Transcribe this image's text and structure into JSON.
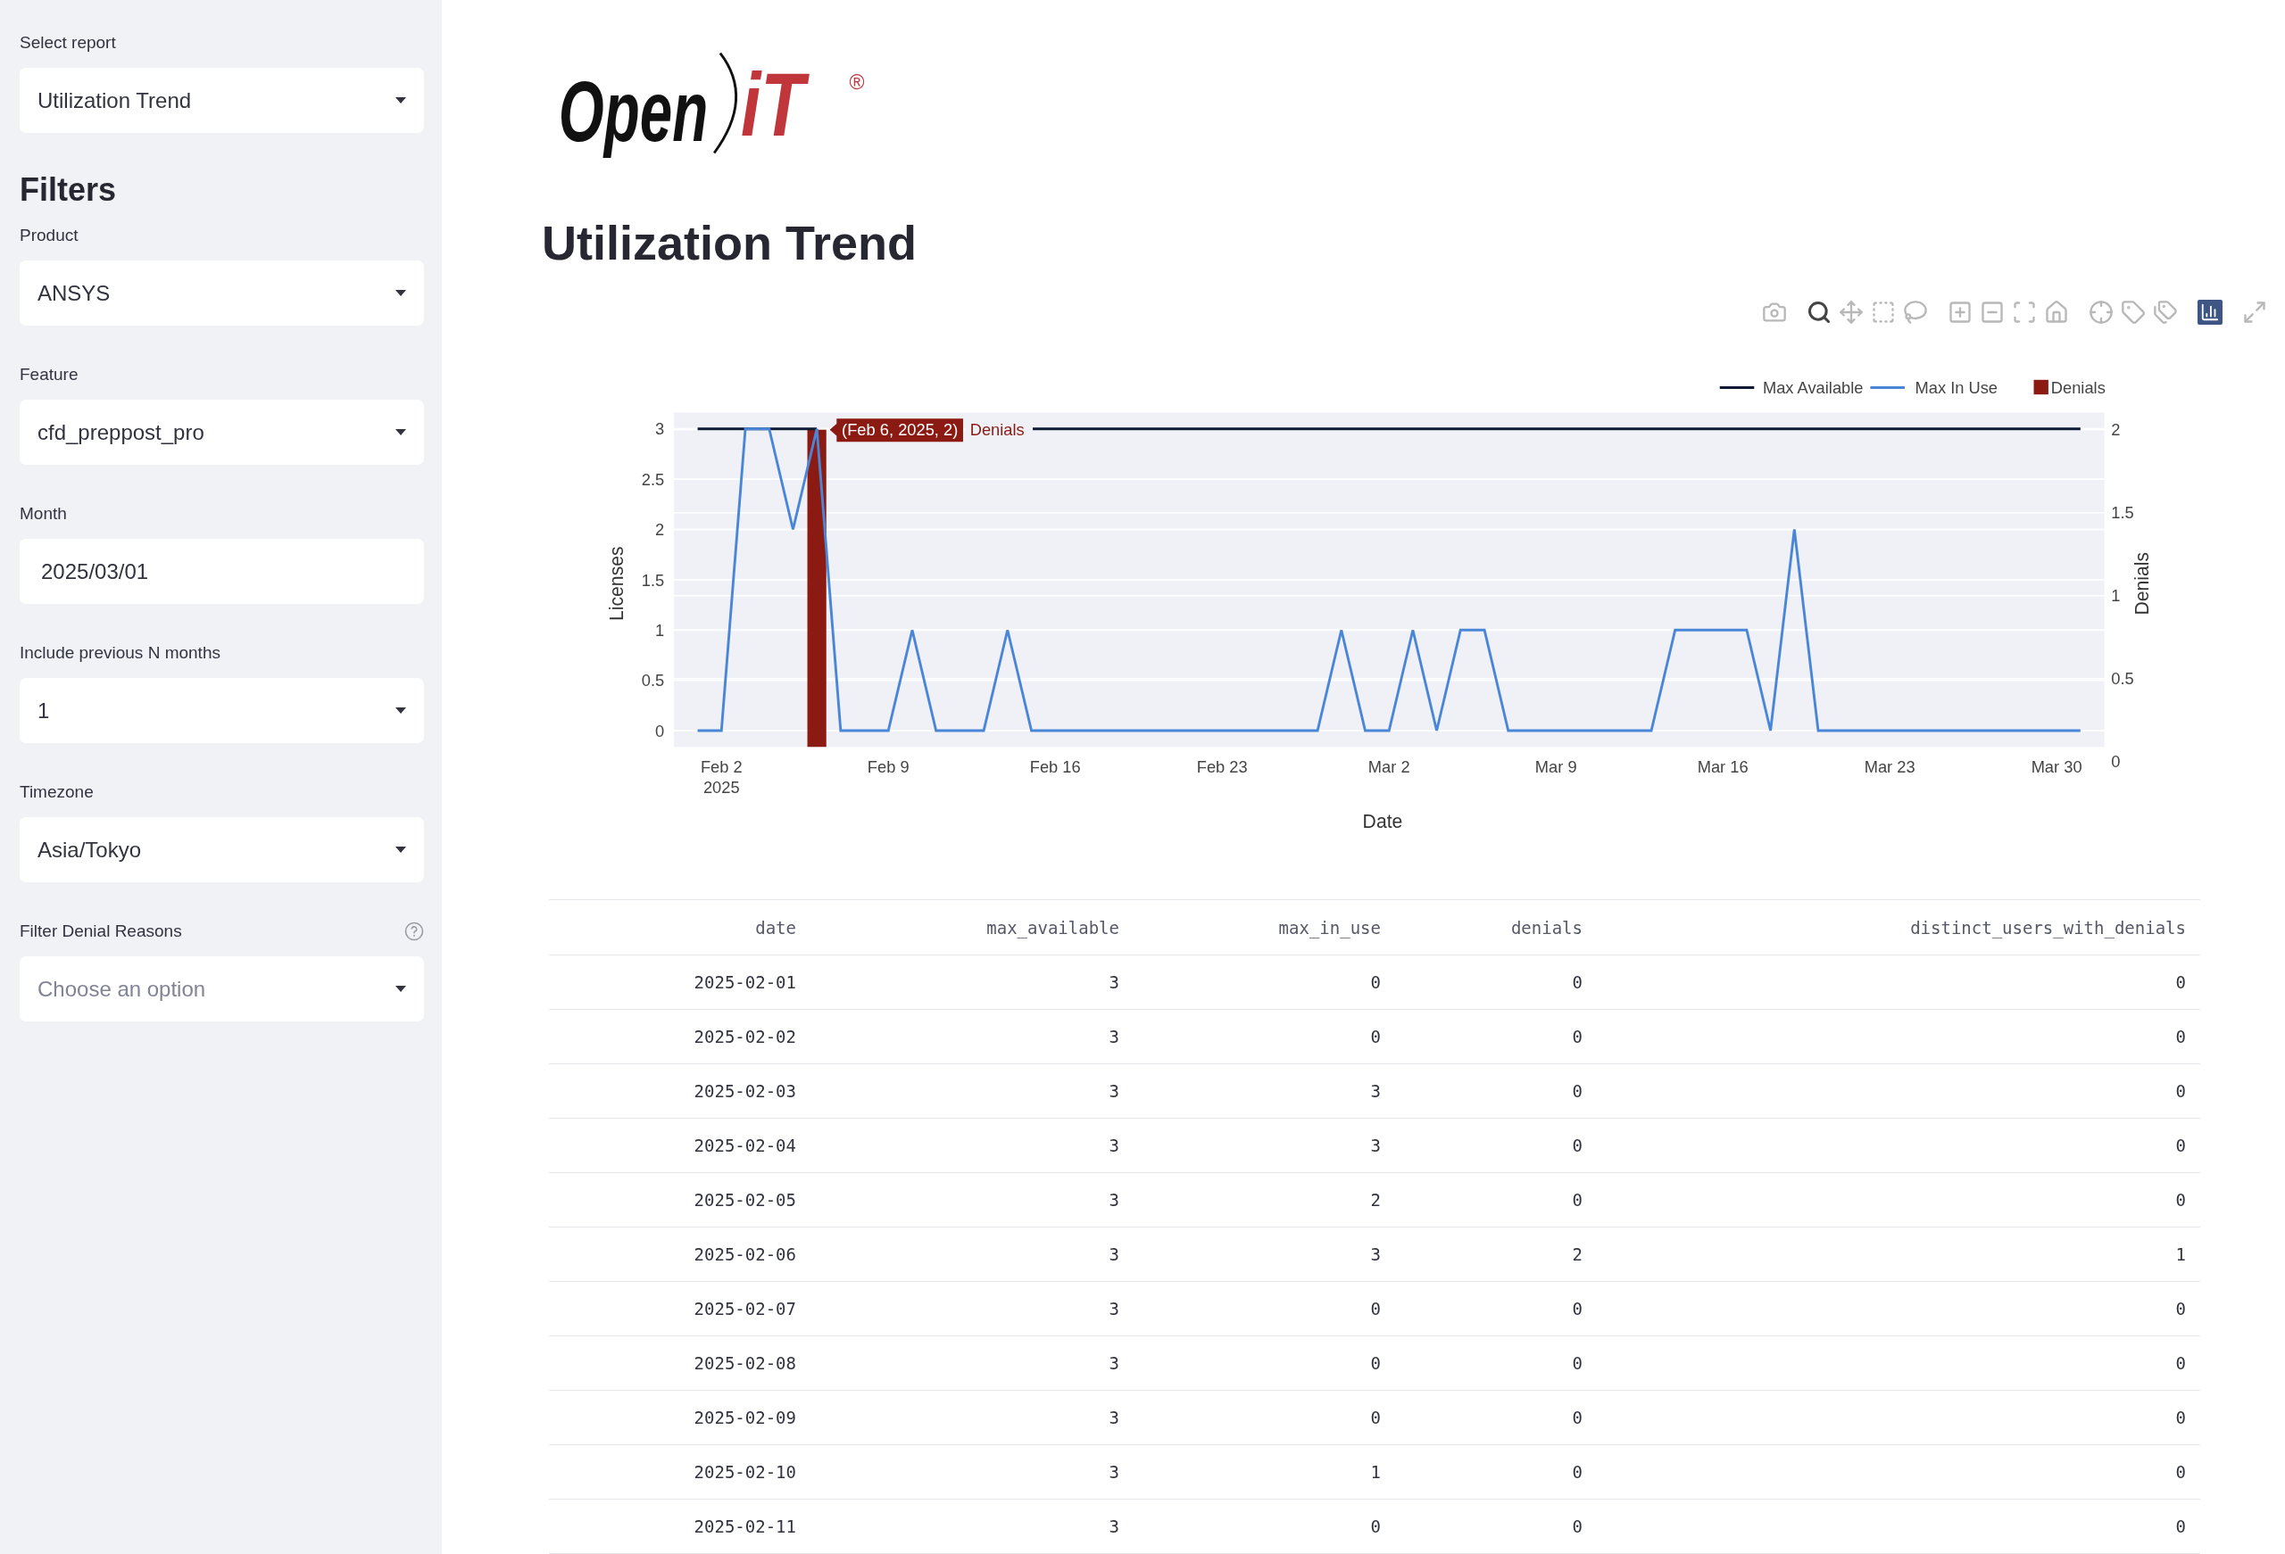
{
  "sidebar": {
    "report": {
      "label": "Select report",
      "value": "Utilization Trend"
    },
    "heading": "Filters",
    "filters": [
      {
        "kind": "select",
        "label": "Product",
        "value": "ANSYS",
        "help": false
      },
      {
        "kind": "select",
        "label": "Feature",
        "value": "cfd_preppost_pro",
        "help": false
      },
      {
        "kind": "date",
        "label": "Month",
        "value": "2025/03/01",
        "help": false
      },
      {
        "kind": "select",
        "label": "Include previous N months",
        "value": "1",
        "help": false
      },
      {
        "kind": "select",
        "label": "Timezone",
        "value": "Asia/Tokyo",
        "help": false
      },
      {
        "kind": "multiselect",
        "label": "Filter Denial Reasons",
        "placeholder": "Choose an option",
        "help": true
      }
    ]
  },
  "logo": {
    "word": "Open",
    "accent": "iT",
    "mark": "®"
  },
  "title": "Utilization Trend",
  "modebar": [
    {
      "kind": "camera",
      "selected": false
    },
    {
      "kind": "zoom",
      "selected": true
    },
    {
      "kind": "pan",
      "selected": false
    },
    {
      "kind": "box-select",
      "selected": false
    },
    {
      "kind": "lasso",
      "selected": false
    },
    {
      "kind": "zoom-in",
      "selected": false
    },
    {
      "kind": "zoom-out",
      "selected": false
    },
    {
      "kind": "autoscale",
      "selected": false
    },
    {
      "kind": "home",
      "selected": false
    },
    {
      "kind": "spikelines",
      "selected": false
    },
    {
      "kind": "hover-closest",
      "selected": false
    },
    {
      "kind": "hover-compare",
      "selected": false
    },
    {
      "kind": "logo",
      "selected": false
    },
    {
      "kind": "fullscreen",
      "selected": false
    }
  ],
  "chart": {
    "chart_data": {
      "type": "line",
      "xlabel": "Date",
      "ylabel": "Licenses",
      "y2label": "Denials",
      "x": [
        "2025-02-01",
        "2025-02-02",
        "2025-02-03",
        "2025-02-04",
        "2025-02-05",
        "2025-02-06",
        "2025-02-07",
        "2025-02-08",
        "2025-02-09",
        "2025-02-10",
        "2025-02-11",
        "2025-02-12",
        "2025-02-13",
        "2025-02-14",
        "2025-02-15",
        "2025-02-16",
        "2025-02-17",
        "2025-02-18",
        "2025-02-19",
        "2025-02-20",
        "2025-02-21",
        "2025-02-22",
        "2025-02-23",
        "2025-02-24",
        "2025-02-25",
        "2025-02-26",
        "2025-02-27",
        "2025-02-28",
        "2025-03-01",
        "2025-03-02",
        "2025-03-03",
        "2025-03-04",
        "2025-03-05",
        "2025-03-06",
        "2025-03-07",
        "2025-03-08",
        "2025-03-09",
        "2025-03-10",
        "2025-03-11",
        "2025-03-12",
        "2025-03-13",
        "2025-03-14",
        "2025-03-15",
        "2025-03-16",
        "2025-03-17",
        "2025-03-18",
        "2025-03-19",
        "2025-03-20",
        "2025-03-21",
        "2025-03-22",
        "2025-03-23",
        "2025-03-24",
        "2025-03-25",
        "2025-03-26",
        "2025-03-27",
        "2025-03-28",
        "2025-03-29",
        "2025-03-30",
        "2025-03-31"
      ],
      "series": [
        {
          "name": "Max Available",
          "color": "#0e1a33",
          "values": [
            3,
            3,
            3,
            3,
            3,
            3,
            null,
            null,
            null,
            null,
            null,
            null,
            null,
            null,
            3,
            3,
            3,
            3,
            3,
            3,
            3,
            3,
            3,
            3,
            3,
            3,
            3,
            3,
            3,
            3,
            3,
            3,
            3,
            3,
            3,
            3,
            3,
            3,
            3,
            3,
            3,
            3,
            3,
            3,
            3,
            3,
            3,
            3,
            3,
            3,
            3,
            3,
            3,
            3,
            3,
            3,
            3,
            3,
            3
          ]
        },
        {
          "name": "Max In Use",
          "color": "#4a86d8",
          "values": [
            0,
            0,
            3,
            3,
            2,
            3,
            0,
            0,
            0,
            1,
            0,
            0,
            0,
            1,
            0,
            0,
            0,
            0,
            0,
            0,
            0,
            0,
            0,
            0,
            0,
            0,
            0,
            1,
            0,
            0,
            1,
            0,
            1,
            1,
            0,
            0,
            0,
            0,
            0,
            0,
            0,
            1,
            1,
            1,
            1,
            0,
            2,
            0,
            0,
            0,
            0,
            0,
            0,
            0,
            0,
            0,
            0,
            0,
            0
          ]
        },
        {
          "name": "Denials",
          "color": "#8b1a12",
          "type": "bar",
          "axis": "y2",
          "values": [
            0,
            0,
            0,
            0,
            0,
            2,
            0,
            0,
            0,
            0,
            0,
            0,
            0,
            0,
            0,
            0,
            0,
            0,
            0,
            0,
            0,
            0,
            0,
            0,
            0,
            0,
            0,
            0,
            0,
            0,
            0,
            0,
            0,
            0,
            0,
            0,
            0,
            0,
            0,
            0,
            0,
            0,
            0,
            0,
            0,
            0,
            0,
            0,
            0,
            0,
            0,
            0,
            0,
            0,
            0,
            0,
            0,
            0,
            0
          ]
        }
      ],
      "xlim": [
        "2025-01-31",
        "2025-04-01"
      ],
      "ylim": [
        0,
        3
      ],
      "y2lim": [
        0,
        2
      ],
      "grid": true,
      "legend": "top-right",
      "yticks": [
        0,
        0.5,
        1,
        1.5,
        2,
        2.5,
        3
      ],
      "y2ticks": [
        0,
        0.5,
        1,
        1.5,
        2
      ],
      "xticks": [
        {
          "value": "2025-02-02",
          "label": "Feb 2\n2025"
        },
        {
          "value": "2025-02-09",
          "label": "Feb 9"
        },
        {
          "value": "2025-02-16",
          "label": "Feb 16"
        },
        {
          "value": "2025-02-23",
          "label": "Feb 23"
        },
        {
          "value": "2025-03-02",
          "label": "Mar 2"
        },
        {
          "value": "2025-03-09",
          "label": "Mar 9"
        },
        {
          "value": "2025-03-16",
          "label": "Mar 16"
        },
        {
          "value": "2025-03-23",
          "label": "Mar 23"
        },
        {
          "value": "2025-03-30",
          "label": "Mar 30"
        }
      ],
      "annotations": [
        "(Feb 6, 2025, 2)",
        "Denials"
      ]
    }
  },
  "table": {
    "columns": [
      "date",
      "max_available",
      "max_in_use",
      "denials",
      "distinct_users_with_denials"
    ],
    "rows": [
      [
        "2025-02-01",
        "3",
        "0",
        "0",
        "0"
      ],
      [
        "2025-02-02",
        "3",
        "0",
        "0",
        "0"
      ],
      [
        "2025-02-03",
        "3",
        "3",
        "0",
        "0"
      ],
      [
        "2025-02-04",
        "3",
        "3",
        "0",
        "0"
      ],
      [
        "2025-02-05",
        "3",
        "2",
        "0",
        "0"
      ],
      [
        "2025-02-06",
        "3",
        "3",
        "2",
        "1"
      ],
      [
        "2025-02-07",
        "3",
        "0",
        "0",
        "0"
      ],
      [
        "2025-02-08",
        "3",
        "0",
        "0",
        "0"
      ],
      [
        "2025-02-09",
        "3",
        "0",
        "0",
        "0"
      ],
      [
        "2025-02-10",
        "3",
        "1",
        "0",
        "0"
      ],
      [
        "2025-02-11",
        "3",
        "0",
        "0",
        "0"
      ]
    ]
  }
}
